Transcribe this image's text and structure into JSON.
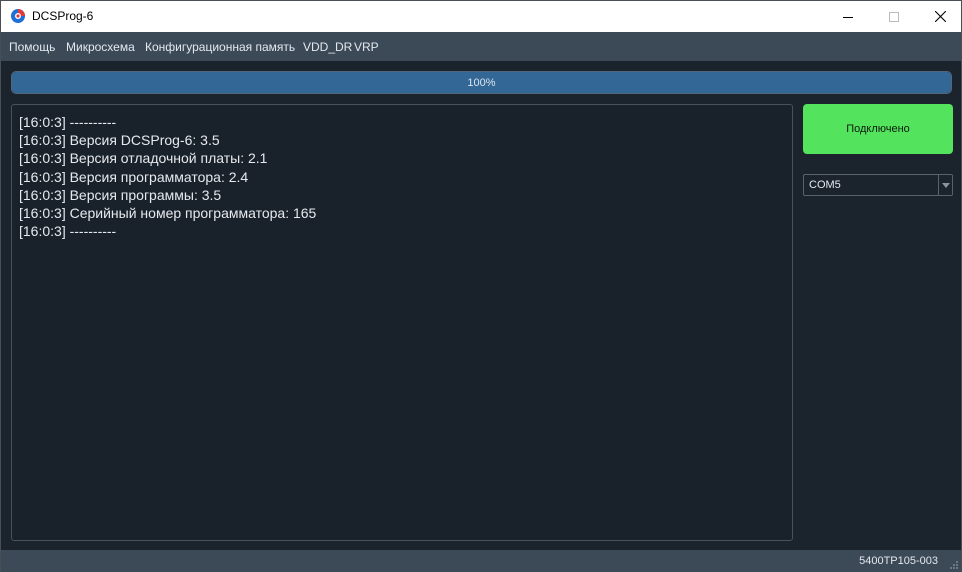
{
  "window": {
    "title": "DCSProg-6",
    "icon": "app-logo-icon",
    "controls": [
      "minimize-icon",
      "maximize-icon",
      "close-icon"
    ]
  },
  "menu": {
    "items": [
      "Помощь",
      "Микросхема",
      "Конфигурационная память",
      "VDD_DR",
      "VRP"
    ]
  },
  "progress": {
    "value": 100,
    "label": "100%"
  },
  "log": {
    "lines": [
      "[16:0:3] ----------",
      "[16:0:3] Версия DCSProg-6: 3.5",
      "[16:0:3] Версия отладочной платы: 2.1",
      "[16:0:3] Версия программатора: 2.4",
      "[16:0:3] Версия программы: 3.5",
      "[16:0:3] Серийный номер программатора: 165",
      "[16:0:3] ----------"
    ]
  },
  "connection": {
    "button_label": "Подключено",
    "button_color": "#54e35c",
    "port_selected": "COM5"
  },
  "status": {
    "chip": "5400ТР105-003"
  },
  "colors": {
    "background": "#1b232c",
    "bars": "#3c4a58",
    "progress_fill": "#336896"
  }
}
